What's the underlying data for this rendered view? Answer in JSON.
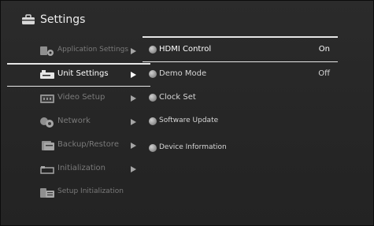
{
  "header": {
    "title": "Settings"
  },
  "categories": [
    {
      "label": "Application Settings"
    },
    {
      "label": "Unit Settings"
    },
    {
      "label": "Video Setup"
    },
    {
      "label": "Network"
    },
    {
      "label": "Backup/Restore"
    },
    {
      "label": "Initialization"
    },
    {
      "label": "Setup Initialization"
    }
  ],
  "options": [
    {
      "label": "HDMI Control",
      "value": "On"
    },
    {
      "label": "Demo Mode",
      "value": "Off"
    },
    {
      "label": "Clock Set"
    },
    {
      "label": "Software Update"
    },
    {
      "label": "Device Information"
    }
  ],
  "colors": {
    "background": "#262626",
    "text": "#ffffff",
    "inactive": "#9a9a9a",
    "highlight": "#e6e6e6"
  }
}
